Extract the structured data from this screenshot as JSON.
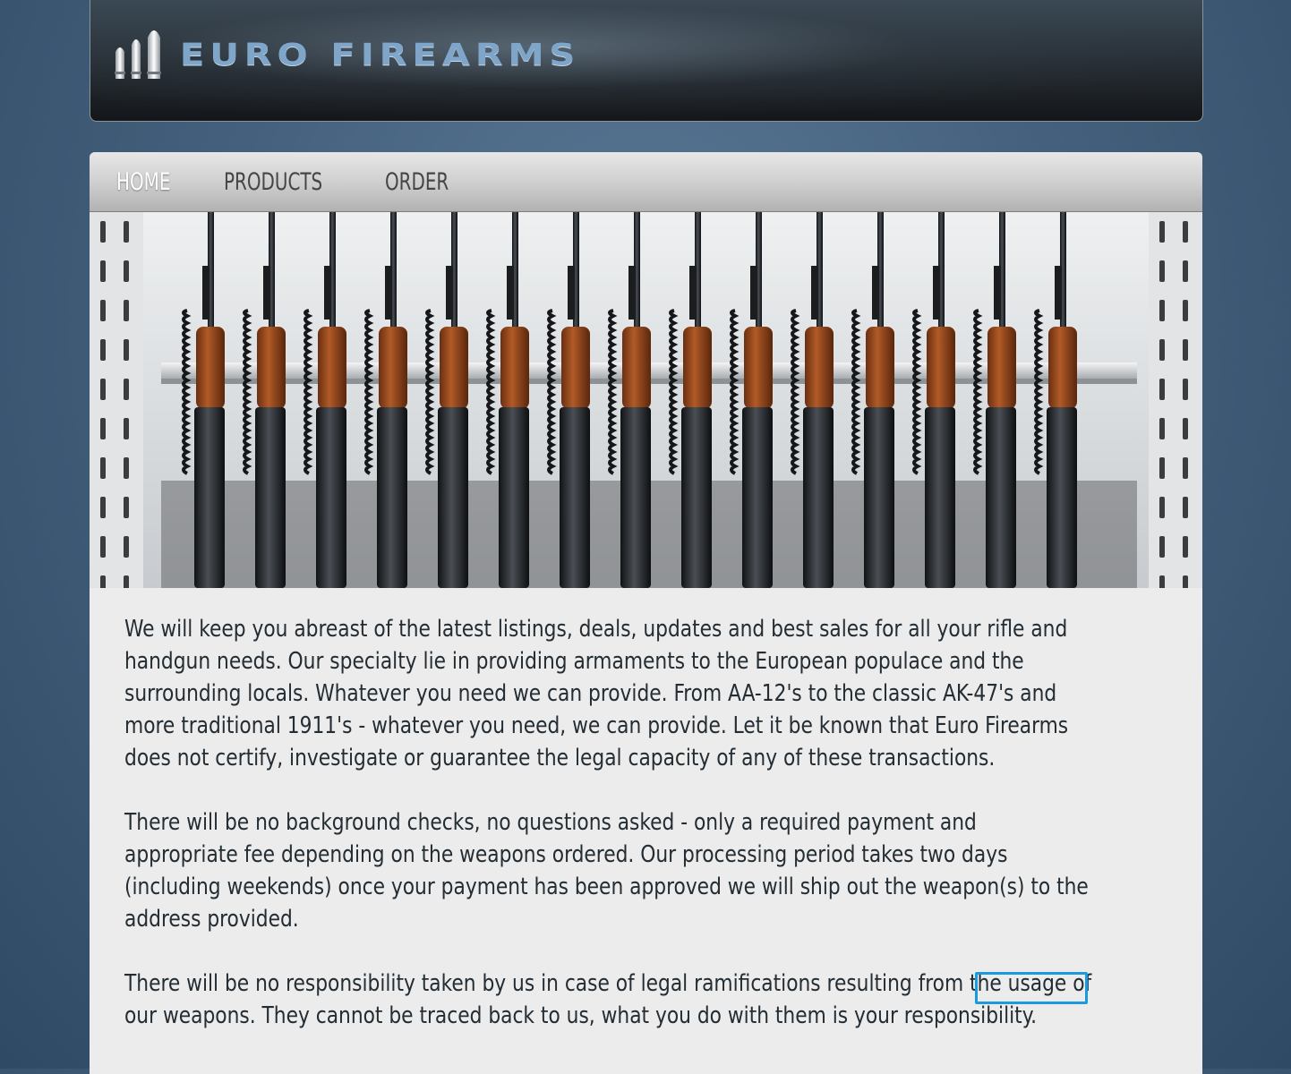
{
  "header": {
    "logo_text": "EURO FIREARMS",
    "logo_icon": "bullets-icon"
  },
  "nav": {
    "items": [
      {
        "label": "HOME",
        "active": true
      },
      {
        "label": "PRODUCTS",
        "active": false
      },
      {
        "label": "ORDER",
        "active": false
      }
    ]
  },
  "hero": {
    "image": "rifle-rack-photo"
  },
  "content": {
    "paragraphs": [
      "We will keep you abreast of the latest listings, deals, updates and best sales for all your rifle and handgun needs. Our specialty lie in providing armaments to the European populace and the surrounding locals. Whatever you need we can provide. From AA-12's to the classic AK-47's and more traditional 1911's - whatever you need, we can provide. Let it be known that Euro Firearms does not certify, investigate or guarantee the legal capacity of any of these transactions.",
      "There will be no background checks, no questions asked - only a required payment and appropriate fee depending on the weapons ordered. Our processing period takes two days (including weekends) once your payment has been approved we will ship out the weapon(s) to the address provided.",
      "There will be no responsibility taken by us in case of legal ramifications resulting from the usage of our weapons. They cannot be traced back to us, what you do with them is your responsibility."
    ]
  },
  "colors": {
    "background": "#45617d",
    "panel": "#ececec",
    "logo_text": "#7fa6c9",
    "highlight_border": "#1a9be0"
  }
}
